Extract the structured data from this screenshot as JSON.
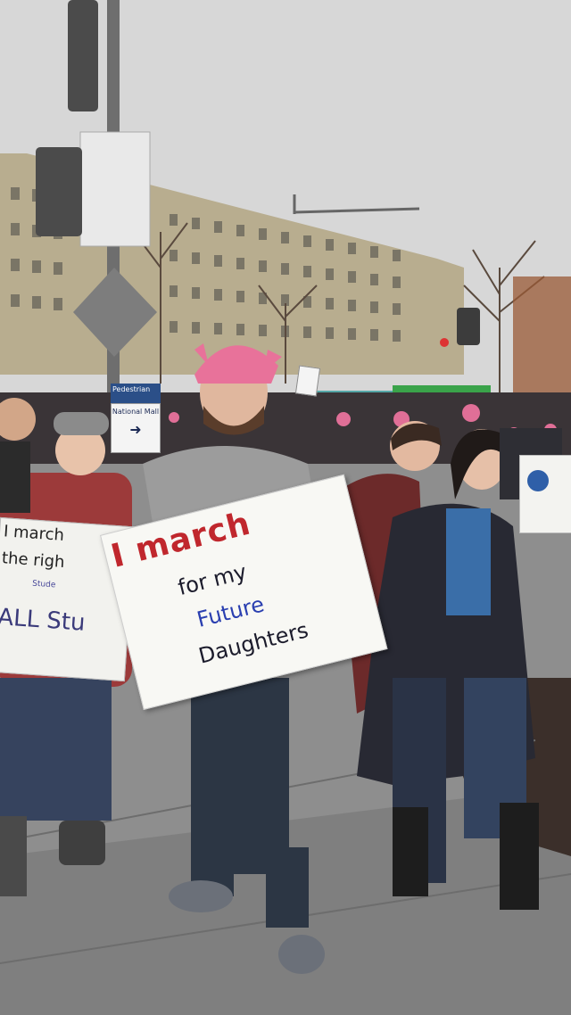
{
  "scene": {
    "description_none": "",
    "main_sign": {
      "line1": "I march",
      "line2": "for my",
      "line3": "Future",
      "line4": "Daughters"
    },
    "left_sign": {
      "line1": "I march",
      "line2": "the righ",
      "line3": "ALL Stu",
      "scribble": "Stude"
    },
    "street_sign": {
      "header": "Pedestrian",
      "label": "National Mall",
      "arrow": "➜"
    },
    "colors": {
      "sky": "#d6d6d6",
      "building": "#b8ad8f",
      "pink_hat": "#e8729a",
      "sign_red": "#c0272d",
      "sign_blue": "#2a3fb0",
      "pavement": "#8f8f8f"
    }
  }
}
